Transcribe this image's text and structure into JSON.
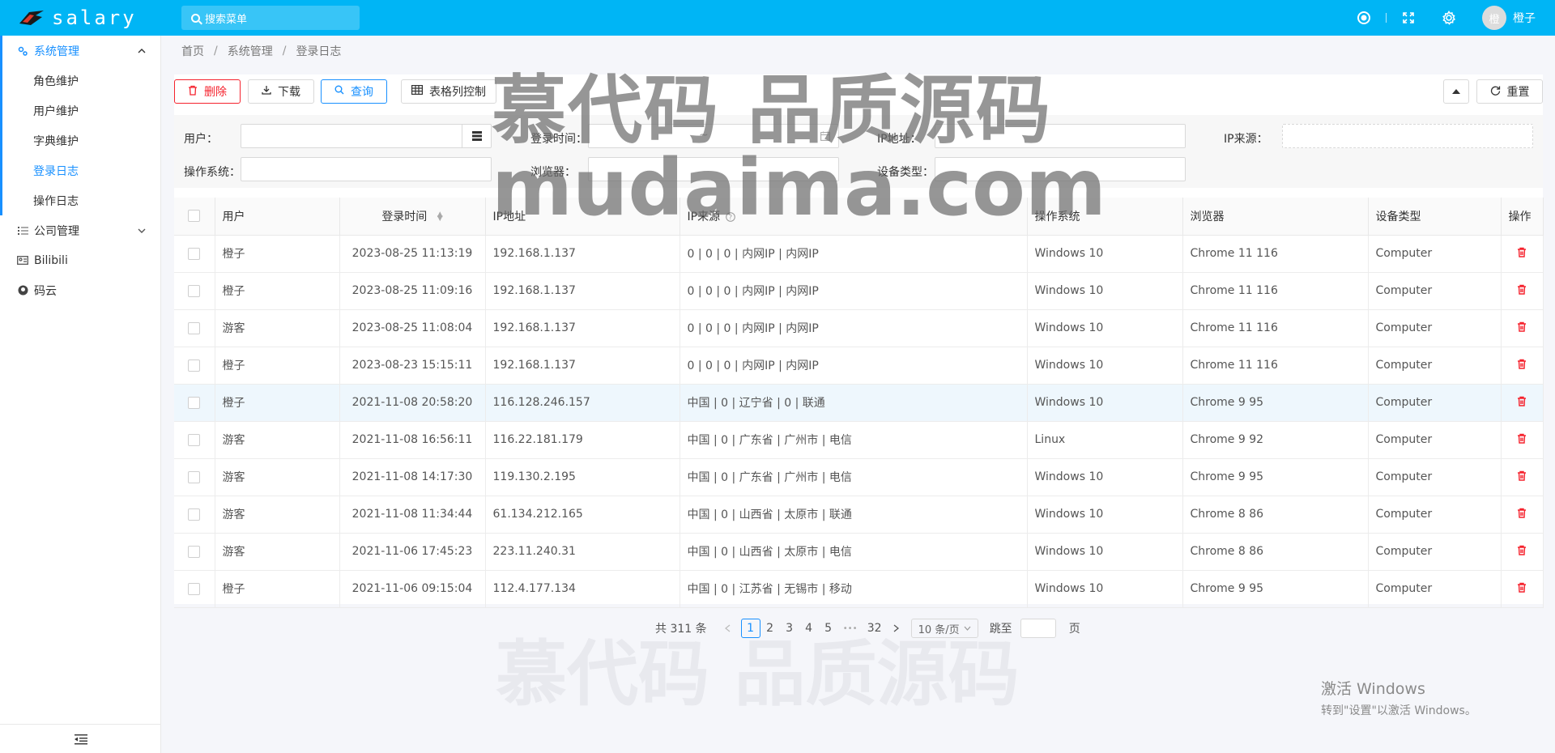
{
  "header": {
    "logo_text": "salary",
    "search_placeholder": "搜索菜单",
    "avatar_text": "橙",
    "user_name": "橙子"
  },
  "sidebar": {
    "groups": [
      {
        "label": "系统管理",
        "icon": "gears-icon",
        "expanded": true
      },
      {
        "label": "公司管理",
        "icon": "list-icon",
        "expanded": false
      },
      {
        "label": "Bilibili",
        "icon": "id-card-icon"
      },
      {
        "label": "码云",
        "icon": "github-icon"
      }
    ],
    "sub_items": [
      "角色维护",
      "用户维护",
      "字典维护",
      "登录日志",
      "操作日志"
    ],
    "active_sub": "登录日志"
  },
  "breadcrumb": [
    "首页",
    "系统管理",
    "登录日志"
  ],
  "toolbar": {
    "delete_label": "删除",
    "download_label": "下载",
    "query_label": "查询",
    "columns_label": "表格列控制",
    "reset_label": "重置"
  },
  "filters": {
    "user_label": "用户：",
    "login_time_label": "登录时间：",
    "range_sep": "~",
    "ip_label": "IP地址：",
    "ip_source_label": "IP来源：",
    "os_label": "操作系统：",
    "browser_label": "浏览器：",
    "device_label": "设备类型："
  },
  "table": {
    "headers": [
      "用户",
      "登录时间",
      "IP地址",
      "IP来源",
      "操作系统",
      "浏览器",
      "设备类型",
      "操作"
    ],
    "rows": [
      [
        "橙子",
        "2023-08-25 11:13:19",
        "192.168.1.137",
        "0 | 0 | 0 | 内网IP | 内网IP",
        "Windows 10",
        "Chrome 11 116",
        "Computer"
      ],
      [
        "橙子",
        "2023-08-25 11:09:16",
        "192.168.1.137",
        "0 | 0 | 0 | 内网IP | 内网IP",
        "Windows 10",
        "Chrome 11 116",
        "Computer"
      ],
      [
        "游客",
        "2023-08-25 11:08:04",
        "192.168.1.137",
        "0 | 0 | 0 | 内网IP | 内网IP",
        "Windows 10",
        "Chrome 11 116",
        "Computer"
      ],
      [
        "橙子",
        "2023-08-23 15:15:11",
        "192.168.1.137",
        "0 | 0 | 0 | 内网IP | 内网IP",
        "Windows 10",
        "Chrome 11 116",
        "Computer"
      ],
      [
        "橙子",
        "2021-11-08 20:58:20",
        "116.128.246.157",
        "中国 | 0 | 辽宁省 | 0 | 联通",
        "Windows 10",
        "Chrome 9 95",
        "Computer"
      ],
      [
        "游客",
        "2021-11-08 16:56:11",
        "116.22.181.179",
        "中国 | 0 | 广东省 | 广州市 | 电信",
        "Linux",
        "Chrome 9 92",
        "Computer"
      ],
      [
        "游客",
        "2021-11-08 14:17:30",
        "119.130.2.195",
        "中国 | 0 | 广东省 | 广州市 | 电信",
        "Windows 10",
        "Chrome 9 95",
        "Computer"
      ],
      [
        "游客",
        "2021-11-08 11:34:44",
        "61.134.212.165",
        "中国 | 0 | 山西省 | 太原市 | 联通",
        "Windows 10",
        "Chrome 8 86",
        "Computer"
      ],
      [
        "游客",
        "2021-11-06 17:45:23",
        "223.11.240.31",
        "中国 | 0 | 山西省 | 太原市 | 电信",
        "Windows 10",
        "Chrome 8 86",
        "Computer"
      ],
      [
        "橙子",
        "2021-11-06 09:15:04",
        "112.4.177.134",
        "中国 | 0 | 江苏省 | 无锡市 | 移动",
        "Windows 10",
        "Chrome 9 95",
        "Computer"
      ]
    ],
    "highlighted_row": 4
  },
  "pagination": {
    "total_text": "共 311 条",
    "pages": [
      "1",
      "2",
      "3",
      "4",
      "5"
    ],
    "ellipsis": "•••",
    "last_page": "32",
    "current_page": "1",
    "page_size": "10 条/页",
    "jump_label": "跳至",
    "page_suffix": "页"
  },
  "watermark": {
    "line1": "慕代码 品质源码",
    "line2": "mudaima.com",
    "line3": "慕代码 品质源码"
  },
  "windows_activation": {
    "title": "激活 Windows",
    "subtitle": "转到\"设置\"以激活 Windows。"
  },
  "colors": {
    "header_bg": "#00b5f5",
    "accent": "#1890ff",
    "danger": "#f5222d"
  }
}
